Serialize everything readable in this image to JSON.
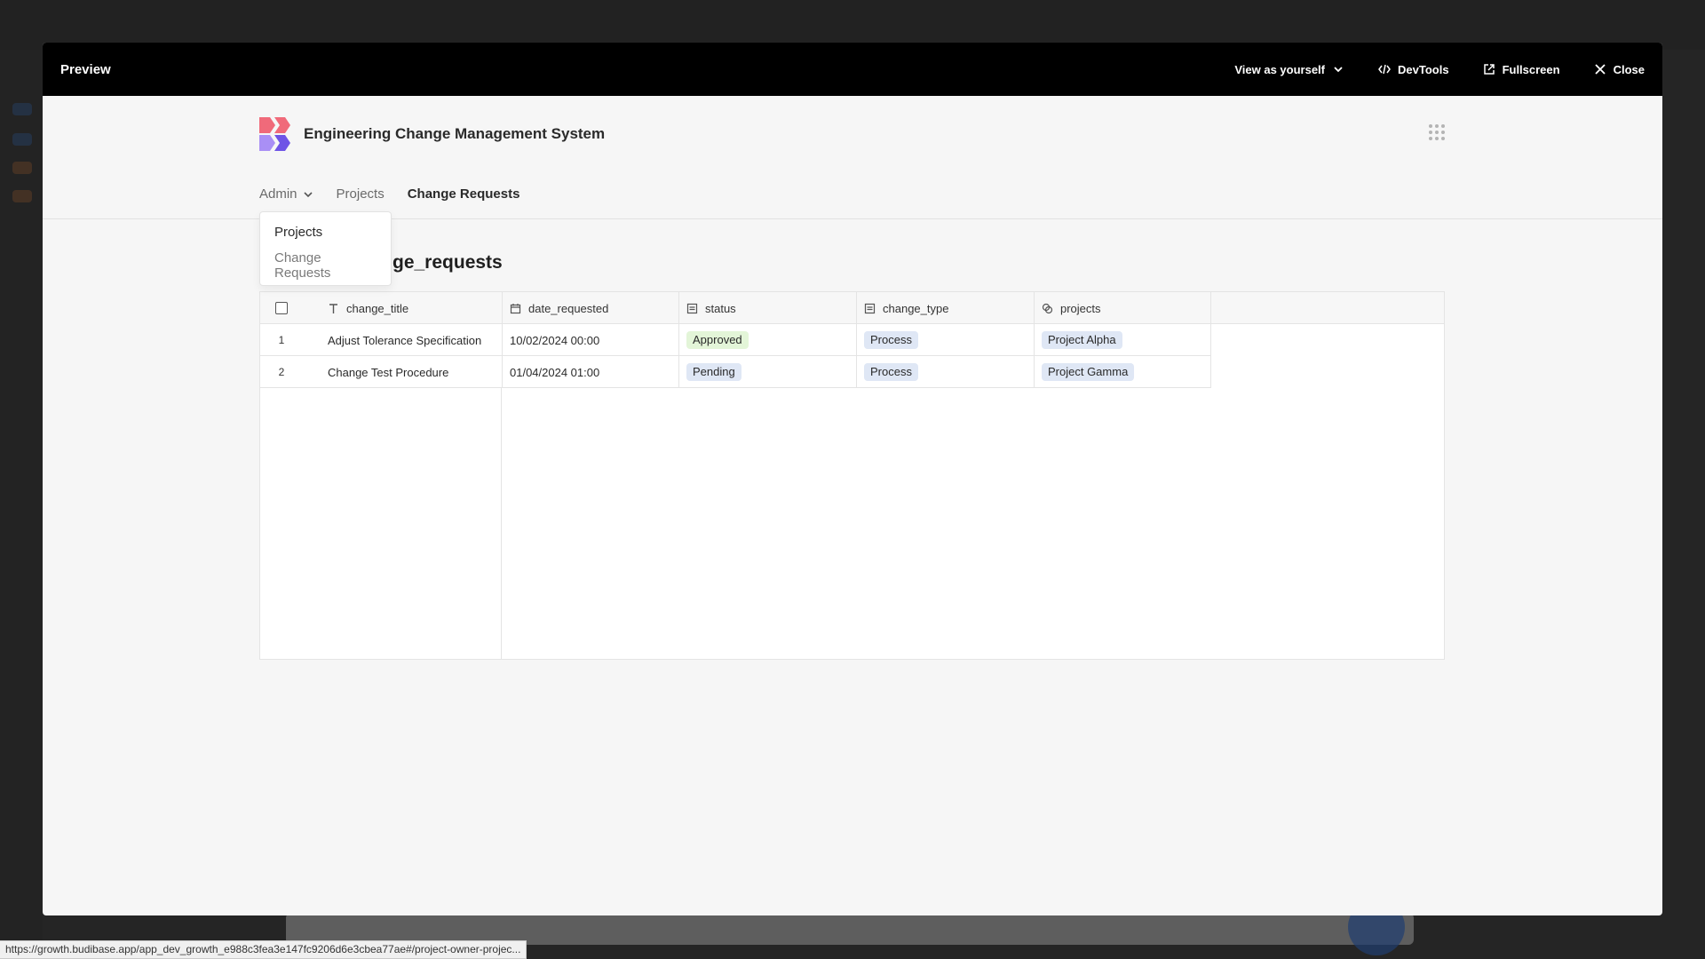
{
  "modal": {
    "title": "Preview",
    "view_as": "View as yourself",
    "devtools": "DevTools",
    "fullscreen": "Fullscreen",
    "close": "Close"
  },
  "app": {
    "name": "Engineering Change Management System",
    "nav": {
      "admin": "Admin",
      "projects": "Projects",
      "change_requests": "Change Requests"
    },
    "dropdown": {
      "items": [
        "Projects",
        "Change Requests"
      ]
    }
  },
  "page": {
    "heading_visible": "ge_requests"
  },
  "table": {
    "columns": [
      {
        "label": "change_title",
        "icon": "text-type-icon"
      },
      {
        "label": "date_requested",
        "icon": "calendar-icon"
      },
      {
        "label": "status",
        "icon": "options-list-icon"
      },
      {
        "label": "change_type",
        "icon": "options-list-icon"
      },
      {
        "label": "projects",
        "icon": "relationship-icon"
      }
    ],
    "rows": [
      {
        "num": "1",
        "change_title": "Adjust Tolerance Specification",
        "date_requested": "10/02/2024 00:00",
        "status": "Approved",
        "change_type": "Process",
        "projects": "Project Alpha"
      },
      {
        "num": "2",
        "change_title": "Change Test Procedure",
        "date_requested": "01/04/2024 01:00",
        "status": "Pending",
        "change_type": "Process",
        "projects": "Project Gamma"
      }
    ]
  },
  "colors": {
    "approved_bg": "#e3f5d8",
    "pending_bg": "#dfe7f5",
    "process_bg": "#dfe7f5",
    "project_bg": "#dfe7f5",
    "logo_pink": "#f06a7a",
    "logo_purple": "#8b6cf0"
  },
  "status_bar": {
    "url": "https://growth.budibase.app/app_dev_growth_e988c3fea3e147fc9206d6e3cbea77ae#/project-owner-projec..."
  }
}
